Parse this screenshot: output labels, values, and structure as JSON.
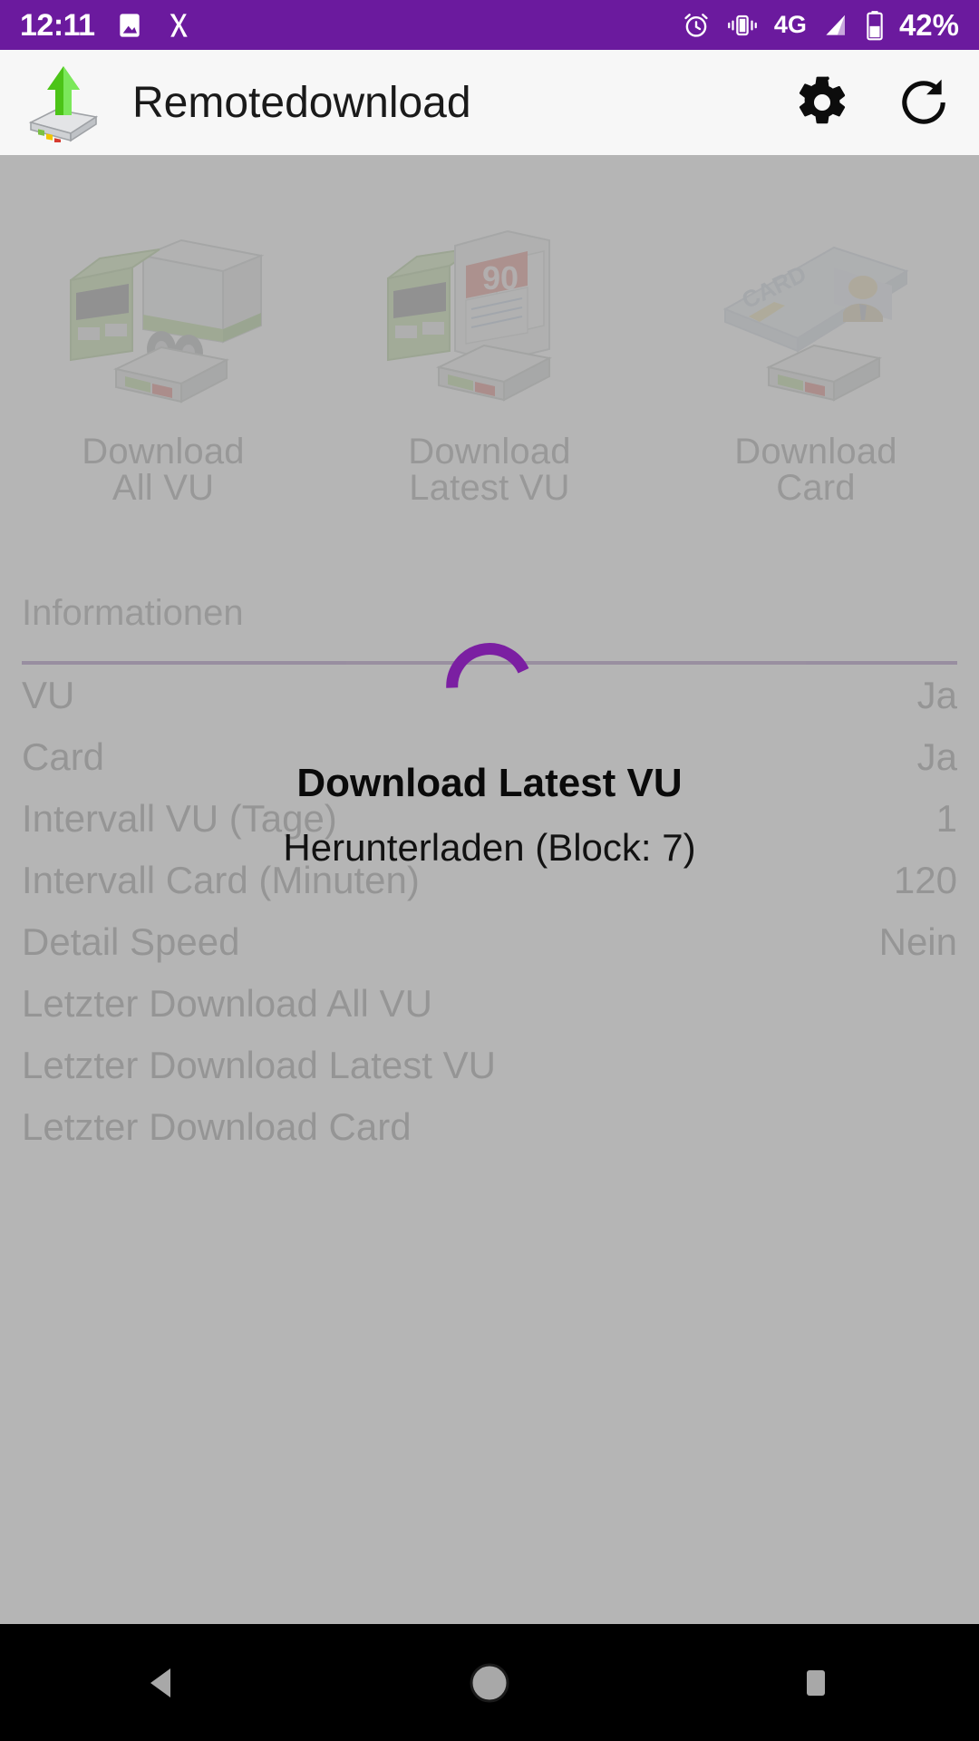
{
  "statusbar": {
    "time": "12:11",
    "battery_percent": "42%",
    "network": "4G",
    "icons": [
      "photo-icon",
      "x-app-icon",
      "alarm-icon",
      "vibrate-icon",
      "signal-icon",
      "battery-icon"
    ],
    "background_color": "#6B1A9E"
  },
  "appbar": {
    "title": "Remotedownload",
    "logo_icon": "remote-download-logo",
    "settings_icon": "gear-icon",
    "refresh_icon": "refresh-icon",
    "background_color": "#F7F7F7"
  },
  "tiles": [
    {
      "line1": "Download",
      "line2": "All VU",
      "icon": "truck-tachograph-icon"
    },
    {
      "line1": "Download",
      "line2": "Latest VU",
      "icon": "truck-calendar-90-icon",
      "calendar_number": "90"
    },
    {
      "line1": "Download",
      "line2": "Card",
      "icon": "driver-card-icon",
      "card_text": "CARD"
    }
  ],
  "section": {
    "title": "Informationen",
    "rule_color": "#7E4FA0"
  },
  "info_rows": [
    {
      "label": "VU",
      "value": "Ja"
    },
    {
      "label": "Card",
      "value": "Ja"
    },
    {
      "label": "Intervall VU (Tage)",
      "value": "1"
    },
    {
      "label": "Intervall Card (Minuten)",
      "value": "120"
    },
    {
      "label": "Detail Speed",
      "value": "Nein"
    },
    {
      "label": "Letzter Download All VU",
      "value": ""
    },
    {
      "label": "Letzter Download Latest VU",
      "value": ""
    },
    {
      "label": "Letzter Download Card",
      "value": ""
    }
  ],
  "dialog": {
    "title": "Download Latest VU",
    "message": "Herunterladen (Block: 7)",
    "spinner_color": "#7B1FA2",
    "spinner_icon": "progress-spinner-icon"
  },
  "navbar": {
    "back_icon": "back-triangle-icon",
    "home_icon": "home-circle-icon",
    "recents_icon": "recents-square-icon"
  }
}
